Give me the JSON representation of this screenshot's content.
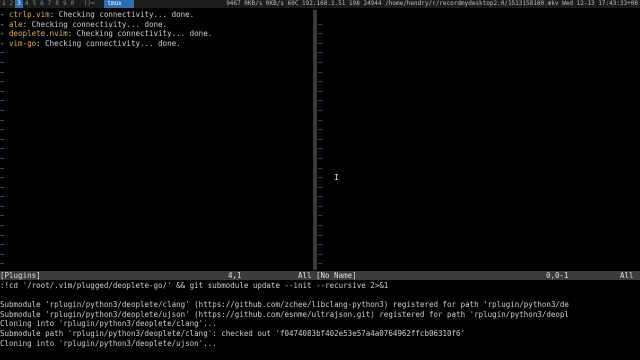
{
  "topbar": {
    "workspaces": [
      "1",
      "2",
      "3",
      "4",
      "5",
      "6",
      "7",
      "8",
      "9",
      "0"
    ],
    "active_workspace": "3",
    "separator": "()=",
    "window_title": "tmux",
    "status_text": "9467 0KB/s 0KB/s 60C  192.168.1.51 198 24944 /home/hendry/r/recordmydesktop2.0/1513158180.mkv Wed 12-13 17:43:33+08"
  },
  "left_pane": {
    "messages": [
      {
        "name": "ctrlp.vim",
        "text": ": Checking connectivity... done."
      },
      {
        "name": "ale",
        "text": ": Checking connectivity... done."
      },
      {
        "name": "deoplete.nvim",
        "text": ": Checking connectivity... done."
      },
      {
        "name": "vim-go",
        "text": ": Checking connectivity... done."
      }
    ],
    "tilde": "~"
  },
  "right_pane": {
    "tilde": "~"
  },
  "statusline": {
    "left_name": "[Plugins]",
    "left_pos": "4,1",
    "left_scroll": "All",
    "right_name": "[No Name]",
    "right_pos": "0,0-1",
    "right_scroll": "All"
  },
  "command_output": [
    ":!cd '/root/.vim/plugged/deoplete-go/' && git submodule update --init --recursive 2>&1",
    "",
    "Submodule 'rplugin/python3/deoplete/clang' (https://github.com/zchee/libclang-python3) registered for path 'rplugin/python3/de",
    "Submodule 'rplugin/python3/deoplete/ujson' (https://github.com/esnme/ultrajson.git) registered for path 'rplugin/python3/deopl",
    "Cloning into 'rplugin/python3/deoplete/clang'...",
    "Submodule path 'rplugin/python3/deoplete/clang': checked out 'f0474083bf402e53e57a4a0764962ffcb06310f6'",
    "Cloning into 'rplugin/python3/deoplete/ujson'..."
  ]
}
